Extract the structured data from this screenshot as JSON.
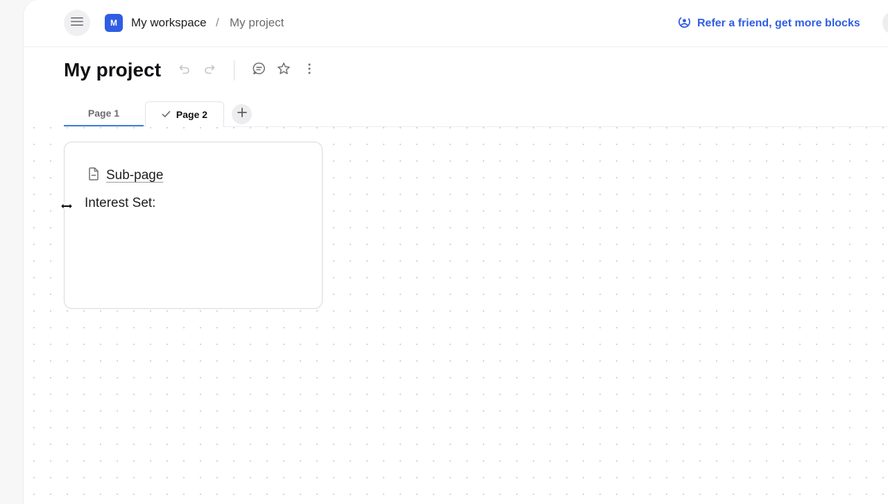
{
  "header": {
    "workspace_initial": "M",
    "workspace_name": "My workspace",
    "separator": "/",
    "project_name": "My project",
    "refer_label": "Refer a friend, get more blocks"
  },
  "title": {
    "text": "My project"
  },
  "tabs": [
    {
      "label": "Page 1",
      "state": "underlined"
    },
    {
      "label": "Page 2",
      "state": "active-checked"
    }
  ],
  "card": {
    "subpage_label": "Sub-page",
    "text": "Interest Set:"
  },
  "icons": {
    "menu": "hamburger-menu-icon",
    "refer": "referral-user-icon",
    "undo": "undo-icon",
    "redo": "redo-icon",
    "comment": "comment-icon",
    "star": "star-icon",
    "more": "more-vertical-icon",
    "check": "check-icon",
    "add": "plus-icon",
    "document": "document-icon",
    "cursor": "resize-horizontal-cursor-icon"
  },
  "colors": {
    "accent": "#2f5de3",
    "tab_underline": "#3b7fd8",
    "workspace_badge": "#2f5de3"
  }
}
